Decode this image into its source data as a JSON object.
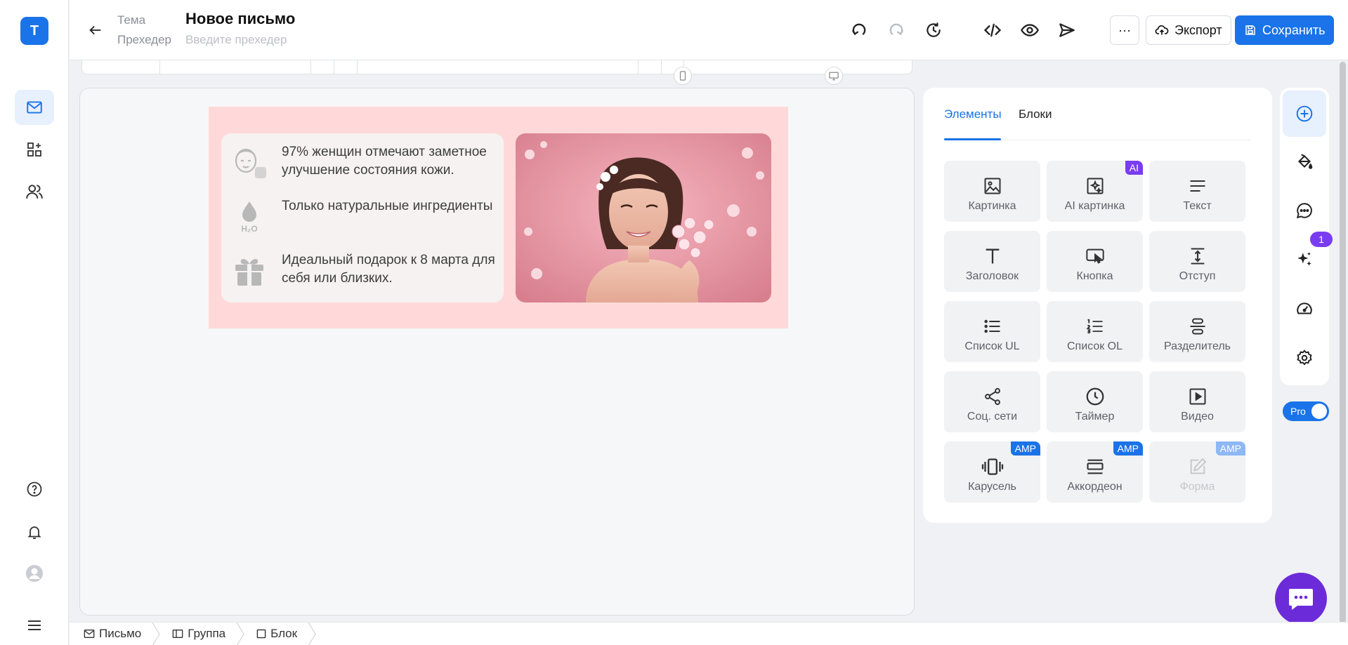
{
  "app": {
    "logo_letter": "T",
    "accent": "#1a73e8",
    "brand_purple": "#7a3cf0"
  },
  "left_rail": {
    "items": [
      {
        "name": "mail-icon",
        "active": true
      },
      {
        "name": "blocks-icon",
        "active": false
      },
      {
        "name": "contacts-icon",
        "active": false
      }
    ],
    "bottom": [
      "help-icon",
      "bell-icon",
      "avatar",
      "menu-icon"
    ]
  },
  "header": {
    "theme_label": "Тема",
    "title": "Новое письмо",
    "preheader_label": "Прехедер",
    "preheader_placeholder": "Введите прехедер",
    "more_label": "···",
    "export_label": "Экспорт",
    "save_label": "Сохранить"
  },
  "email": {
    "background": "#ffd9d9",
    "features": [
      {
        "icon": "face-mask-icon",
        "text": "97% женщин отмечают заметное улучшение состояния кожи."
      },
      {
        "icon": "water-drop-icon",
        "icon_text": "H₂O",
        "text": "Только натуральные ингредиенты"
      },
      {
        "icon": "gift-icon",
        "text": "Идеальный подарок к 8 марта для себя или близких."
      }
    ]
  },
  "panel": {
    "tabs": [
      {
        "label": "Элементы",
        "active": true
      },
      {
        "label": "Блоки",
        "active": false
      }
    ],
    "elements": [
      {
        "label": "Картинка",
        "icon": "image-icon"
      },
      {
        "label": "AI картинка",
        "icon": "ai-image-icon",
        "tag": "AI"
      },
      {
        "label": "Текст",
        "icon": "text-icon"
      },
      {
        "label": "Заголовок",
        "icon": "heading-icon"
      },
      {
        "label": "Кнопка",
        "icon": "button-icon"
      },
      {
        "label": "Отступ",
        "icon": "spacer-icon"
      },
      {
        "label": "Список UL",
        "icon": "list-ul-icon"
      },
      {
        "label": "Список OL",
        "icon": "list-ol-icon"
      },
      {
        "label": "Разделитель",
        "icon": "divider-icon"
      },
      {
        "label": "Соц. сети",
        "icon": "share-icon"
      },
      {
        "label": "Таймер",
        "icon": "clock-icon"
      },
      {
        "label": "Видео",
        "icon": "video-icon"
      },
      {
        "label": "Карусель",
        "icon": "carousel-icon",
        "tag": "AMP"
      },
      {
        "label": "Аккордеон",
        "icon": "accordion-icon",
        "tag": "AMP"
      },
      {
        "label": "Форма",
        "icon": "form-icon",
        "tag": "AMP",
        "disabled": true
      }
    ]
  },
  "right_rail": {
    "items": [
      "add-icon",
      "paint-bucket-icon",
      "comments-icon",
      "sparkles-icon",
      "speedometer-icon",
      "gear-icon"
    ],
    "badge": "1",
    "pro_label": "Pro"
  },
  "breadcrumb": [
    {
      "label": "Письмо",
      "icon": "mail-icon"
    },
    {
      "label": "Группа",
      "icon": "columns-icon"
    },
    {
      "label": "Блок",
      "icon": "square-icon"
    }
  ]
}
